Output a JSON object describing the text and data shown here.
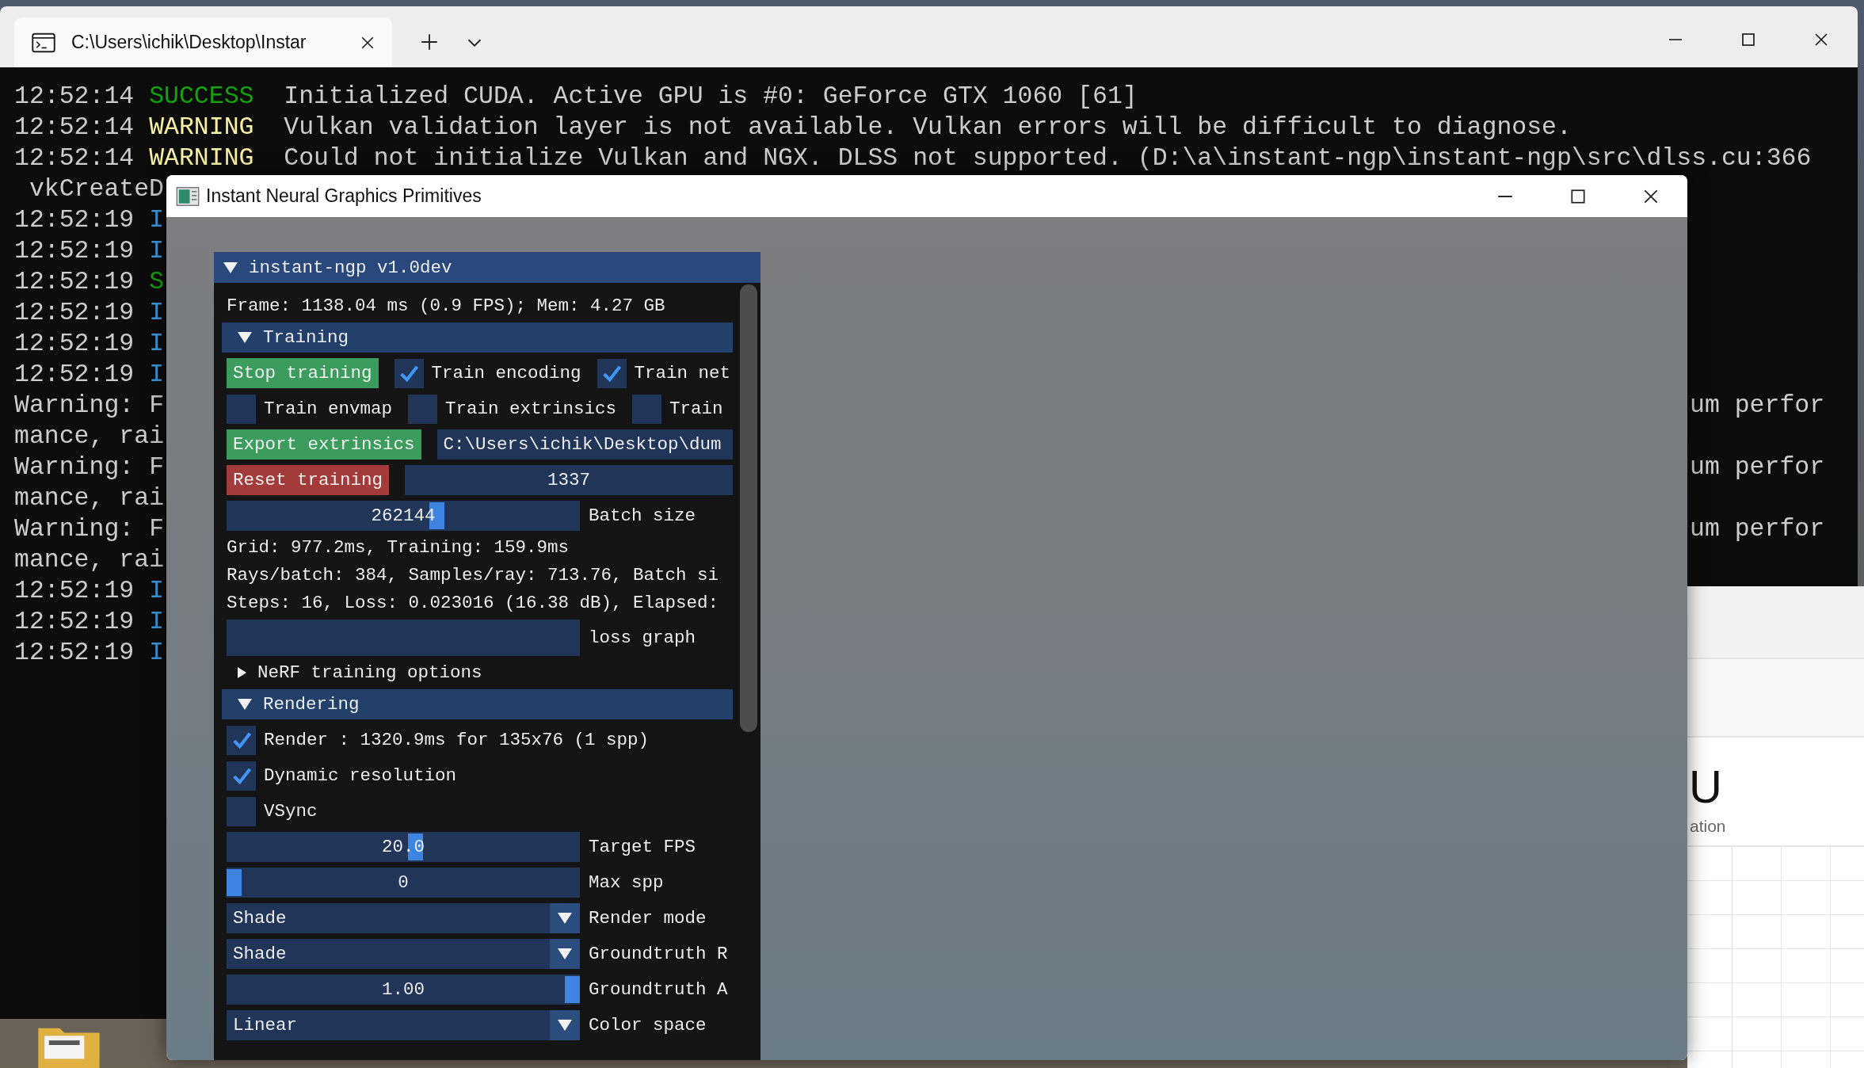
{
  "terminal": {
    "tab": {
      "title": "C:\\Users\\ichik\\Desktop\\Instar",
      "selected": true
    },
    "lines": [
      {
        "kind": "log",
        "time": "12:52:14",
        "level": "SUCCESS",
        "color": "#13a10e",
        "message": "Initialized CUDA. Active GPU is #0: GeForce GTX 1060 [61]"
      },
      {
        "kind": "log",
        "time": "12:52:14",
        "level": "WARNING",
        "color": "#f9f1a5",
        "message": "Vulkan validation layer is not available. Vulkan errors will be difficult to diagnose."
      },
      {
        "kind": "log",
        "time": "12:52:14",
        "level": "WARNING",
        "color": "#f9f1a5",
        "message": "Could not initialize Vulkan and NGX. DLSS not supported. (D:\\a\\instant-ngp\\instant-ngp\\src\\dlss.cu:366"
      },
      {
        "kind": "indented",
        "text": "vkCreateD"
      },
      {
        "kind": "log",
        "time": "12:52:19",
        "level": "I",
        "color": "#3a96dd"
      },
      {
        "kind": "log",
        "time": "12:52:19",
        "level": "I",
        "color": "#3a96dd"
      },
      {
        "kind": "log",
        "time": "12:52:19",
        "level": "S",
        "color": "#13a10e"
      },
      {
        "kind": "log",
        "time": "12:52:19",
        "level": "I",
        "color": "#3a96dd"
      },
      {
        "kind": "log",
        "time": "12:52:19",
        "level": "I",
        "color": "#3a96dd"
      },
      {
        "kind": "log",
        "time": "12:52:19",
        "level": "I",
        "color": "#3a96dd"
      },
      {
        "kind": "text",
        "text": "Warning: F",
        "right": "um perfor"
      },
      {
        "kind": "text",
        "text": "mance, rai"
      },
      {
        "kind": "text",
        "text": "Warning: F",
        "right": "um perfor"
      },
      {
        "kind": "text",
        "text": "mance, rai"
      },
      {
        "kind": "text",
        "text": "Warning: F",
        "right": "um perfor"
      },
      {
        "kind": "text",
        "text": "mance, rai"
      },
      {
        "kind": "log",
        "time": "12:52:19",
        "level": "I",
        "color": "#3a96dd"
      },
      {
        "kind": "log",
        "time": "12:52:19",
        "level": "I",
        "color": "#3a96dd"
      },
      {
        "kind": "log",
        "time": "12:52:19",
        "level": "I",
        "color": "#3a96dd"
      }
    ]
  },
  "browser_page": {
    "heading": "U",
    "subtitle": "ation"
  },
  "app_window": {
    "title": "Instant Neural Graphics Primitives",
    "panel": {
      "title": "instant-ngp v1.0dev",
      "expanded": true,
      "items": [
        {
          "kind": "text",
          "text": "Frame: 1138.04 ms (0.9 FPS); Mem: 4.27 GB"
        },
        {
          "kind": "header",
          "label": "Training",
          "expanded": true
        },
        {
          "kind": "row",
          "controls": [
            {
              "kind": "button",
              "label": "Stop training",
              "color": "#3b9c5d"
            },
            {
              "kind": "checkbox",
              "label": "Train encoding",
              "checked": true
            },
            {
              "kind": "checkbox",
              "label": "Train net",
              "checked": true
            }
          ]
        },
        {
          "kind": "row",
          "controls": [
            {
              "kind": "checkbox",
              "label": "Train envmap",
              "checked": false
            },
            {
              "kind": "checkbox",
              "label": "Train extrinsics",
              "checked": false
            },
            {
              "kind": "checkbox",
              "label": "Train",
              "checked": false
            }
          ]
        },
        {
          "kind": "row",
          "controls": [
            {
              "kind": "button",
              "label": "Export extrinsics",
              "color": "#3b9c5d"
            },
            {
              "kind": "text_field",
              "value": "C:\\Users\\ichik\\Desktop\\dum"
            }
          ]
        },
        {
          "kind": "row",
          "controls": [
            {
              "kind": "button",
              "label": "Reset training",
              "color": "#a33b3b"
            },
            {
              "kind": "number_field",
              "value": "1337"
            }
          ]
        },
        {
          "kind": "slider",
          "value": "262144",
          "level": 0.6,
          "label": "Batch size"
        },
        {
          "kind": "text",
          "text": "Grid: 977.2ms, Training: 159.9ms"
        },
        {
          "kind": "text",
          "text": "Rays/batch: 384, Samples/ray: 713.76, Batch si"
        },
        {
          "kind": "text",
          "text": "Steps: 16, Loss: 0.023016 (16.38 dB), Elapsed:"
        },
        {
          "kind": "plot",
          "label": "loss graph"
        },
        {
          "kind": "node",
          "label": "NeRF training options",
          "expanded": false
        },
        {
          "kind": "header",
          "label": "Rendering",
          "expanded": true
        },
        {
          "kind": "checkbox",
          "label": "Render : 1320.9ms for 135x76 (1 spp)",
          "checked": true
        },
        {
          "kind": "checkbox",
          "label": "Dynamic resolution",
          "checked": true
        },
        {
          "kind": "checkbox",
          "label": "VSync",
          "checked": false
        },
        {
          "kind": "slider",
          "value": "20.0",
          "level": 0.537,
          "label": "Target FPS"
        },
        {
          "kind": "slider",
          "value": "0",
          "level": 0,
          "label": "Max spp"
        },
        {
          "kind": "combo",
          "value": "Shade",
          "label": "Render mode"
        },
        {
          "kind": "combo",
          "value": "Shade",
          "label": "Groundtruth R"
        },
        {
          "kind": "slider",
          "value": "1.00",
          "level": 1,
          "label": "Groundtruth A"
        },
        {
          "kind": "combo",
          "value": "Linear",
          "label": "Color space"
        }
      ]
    }
  }
}
